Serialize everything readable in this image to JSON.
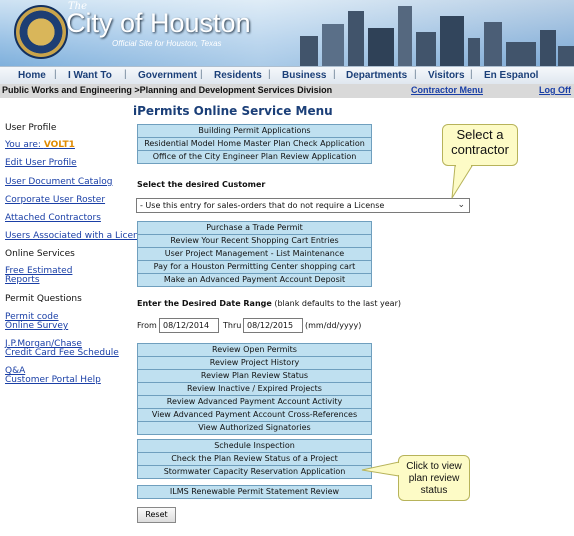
{
  "header": {
    "brand_the": "The",
    "brand_city": "City of Houston",
    "brand_sub": "Official Site for Houston, Texas"
  },
  "nav": {
    "items": [
      "Home",
      "I Want To",
      "Government",
      "Residents",
      "Business",
      "Departments",
      "Visitors",
      "En Espanol"
    ]
  },
  "breadcrumb": {
    "text": "Public Works and Engineering >Planning and Development Services Division",
    "contractor_menu": "Contractor Menu",
    "log_off": "Log Off"
  },
  "sidebar": {
    "user_profile": "User Profile",
    "you_are_label": "You are:",
    "you_are_value": "VOLT1",
    "edit_user_profile": "Edit User Profile",
    "user_document_catalog": "User Document Catalog",
    "corporate_user_roster": "Corporate User Roster",
    "attached_contractors": "Attached Contractors",
    "users_associated": "Users Associated with a License",
    "online_services": "Online Services",
    "free_estimated_1": "Free Estimated",
    "free_estimated_2": "Reports",
    "permit_questions": "Permit Questions",
    "permit_code_1": "Permit code",
    "permit_code_2": "Online Survey",
    "jpmorgan_1": "J.P.Morgan/Chase",
    "jpmorgan_2": "Credit Card Fee Schedule",
    "qa_1": "Q&A",
    "qa_2": "Customer Portal Help"
  },
  "main": {
    "title": "iPermits Online Service Menu",
    "group1": [
      "Building Permit Applications",
      "Residential Model Home Master Plan Check Application",
      "Office of the City Engineer Plan Review Application"
    ],
    "customer_label": "Select the desired Customer",
    "customer_selected": "- Use this entry for sales-orders that do not require a License",
    "group2": [
      "Purchase a Trade Permit",
      "Review Your Recent Shopping Cart Entries",
      "User Project Management - List Maintenance",
      "Pay for a Houston Permitting Center shopping cart",
      "Make an Advanced Payment Account Deposit"
    ],
    "date_range_label": "Enter the Desired Date Range",
    "date_range_note": "(blank defaults to the last year)",
    "from_label": "From",
    "from_value": "08/12/2014",
    "thru_label": "Thru",
    "thru_value": "08/12/2015",
    "date_format": "(mm/dd/yyyy)",
    "group3": [
      "Review Open Permits",
      "Review Project History",
      "Review Plan Review Status",
      "Review Inactive / Expired Projects",
      "Review Advanced Payment Account Activity",
      "View Advanced Payment Account Cross-References",
      "View Authorized Signatories"
    ],
    "group4": [
      "Schedule Inspection",
      "Check the Plan Review Status of a Project",
      "Stormwater Capacity Reservation Application"
    ],
    "ilms_button": "ILMS Renewable Permit Statement Review",
    "reset_button": "Reset"
  },
  "callouts": {
    "select_contractor_1": "Select a",
    "select_contractor_2": "contractor",
    "plan_review_1": "Click to view",
    "plan_review_2": "plan review",
    "plan_review_3": "status"
  },
  "colors": {
    "link": "#1a3fa6",
    "button_bg": "#bfe0f0",
    "title": "#1b3f78",
    "callout_bg": "#fdfbc6"
  }
}
